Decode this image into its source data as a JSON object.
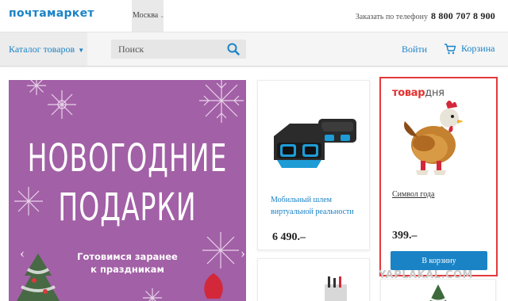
{
  "header": {
    "logo": "почтамаркет",
    "city": "Москва",
    "phone_label": "Заказать по телефону",
    "phone_number": "8 800 707 8 900"
  },
  "nav": {
    "catalog_label": "Каталог товаров",
    "search_placeholder": "Поиск",
    "login_label": "Войти",
    "cart_label": "Корзина"
  },
  "banner": {
    "title_line1": "НОВОГОДНИЕ",
    "title_line2": "ПОДАРКИ",
    "subtitle_line1": "Готовимся заранее",
    "subtitle_line2": "к праздникам",
    "bg_color": "#a260a6"
  },
  "products": [
    {
      "name": "Мобильный шлем виртуальной реальности",
      "price": "6 490.–"
    }
  ],
  "deal_of_day": {
    "title_accent": "товар",
    "title_rest": "дня",
    "product_name": "Символ года",
    "price": "399.–",
    "buy_label": "В корзину",
    "accent_color": "#e23a3a"
  },
  "watermark": "YAPLAKAL.COM",
  "colors": {
    "brand": "#1a83c6",
    "price": "#222222"
  }
}
